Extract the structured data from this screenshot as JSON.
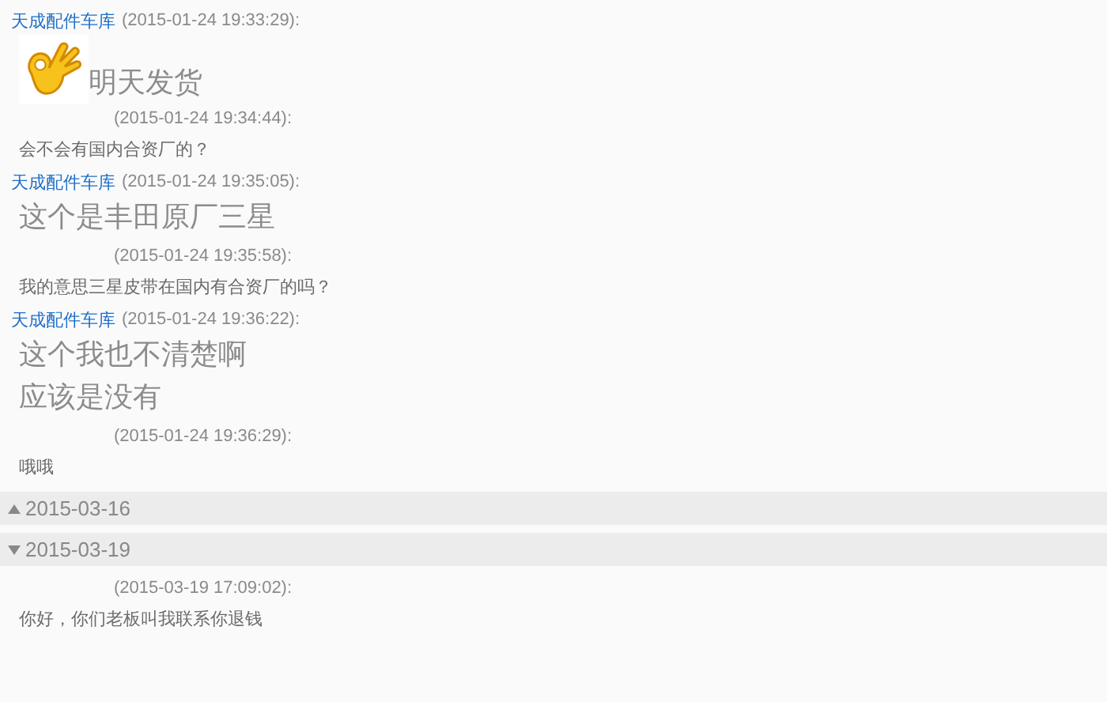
{
  "sections": [
    {
      "messages": [
        {
          "sender": "天成配件车库",
          "time": "(2015-01-24 19:33:29):",
          "kind": "emoji",
          "lines": [
            "明天发货"
          ]
        },
        {
          "time": "(2015-01-24 19:34:44):",
          "kind": "small",
          "lines": [
            "会不会有国内合资厂的？"
          ]
        },
        {
          "sender": "天成配件车库",
          "time": "(2015-01-24 19:35:05):",
          "kind": "large",
          "lines": [
            "这个是丰田原厂三星"
          ]
        },
        {
          "time": "(2015-01-24 19:35:58):",
          "kind": "small",
          "lines": [
            "我的意思三星皮带在国内有合资厂的吗？"
          ]
        },
        {
          "sender": "天成配件车库",
          "time": "(2015-01-24 19:36:22):",
          "kind": "large",
          "lines": [
            "这个我也不清楚啊",
            "应该是没有"
          ]
        },
        {
          "time": "(2015-01-24 19:36:29):",
          "kind": "small",
          "lines": [
            "哦哦"
          ]
        }
      ]
    },
    {
      "date": "2015-03-16",
      "expanded": false
    },
    {
      "date": "2015-03-19",
      "expanded": true,
      "messages": [
        {
          "time": "(2015-03-19 17:09:02):",
          "kind": "small",
          "lines": [
            "你好，你们老板叫我联系你退钱"
          ]
        }
      ]
    }
  ]
}
